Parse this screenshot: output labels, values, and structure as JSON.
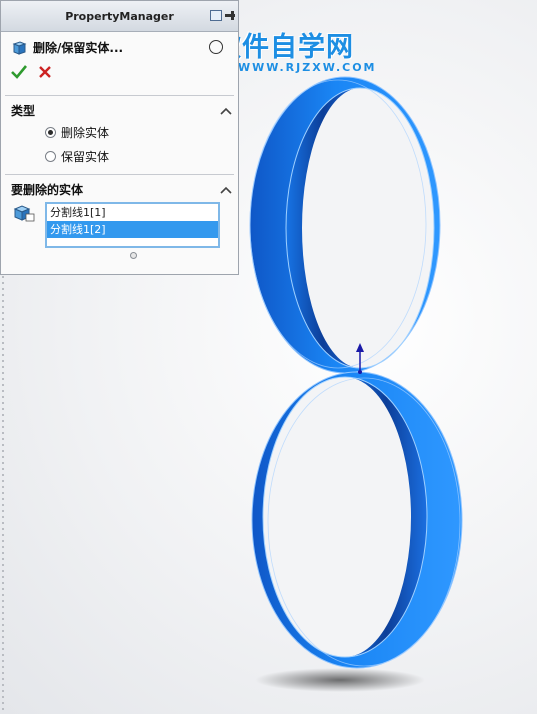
{
  "panel": {
    "title": "PropertyManager",
    "feature_name": "删除/保留实体...",
    "sections": {
      "type": {
        "heading": "类型",
        "options": [
          {
            "label": "删除实体",
            "selected": true
          },
          {
            "label": "保留实体",
            "selected": false
          }
        ]
      },
      "bodies": {
        "heading": "要删除的实体",
        "items": [
          {
            "label": "分割线1[1]",
            "selected": false
          },
          {
            "label": "分割线1[2]",
            "selected": true
          }
        ]
      }
    }
  },
  "watermark": {
    "text": "软件自学网",
    "url": "WWW.RJZXW.COM"
  },
  "colors": {
    "ring_blue": "#1a7ef2",
    "ring_dark": "#0d3f9c",
    "accent_blue": "#1d8ee3",
    "selection_blue": "#3399ee",
    "ok_green": "#2e9a2e",
    "cancel_red": "#cc2222"
  },
  "icons": [
    "feature-body-icon",
    "ok-check-icon",
    "cancel-x-icon",
    "chevron-up-icon",
    "pin-icon",
    "solid-bodies-icon",
    "help-circle-icon"
  ]
}
